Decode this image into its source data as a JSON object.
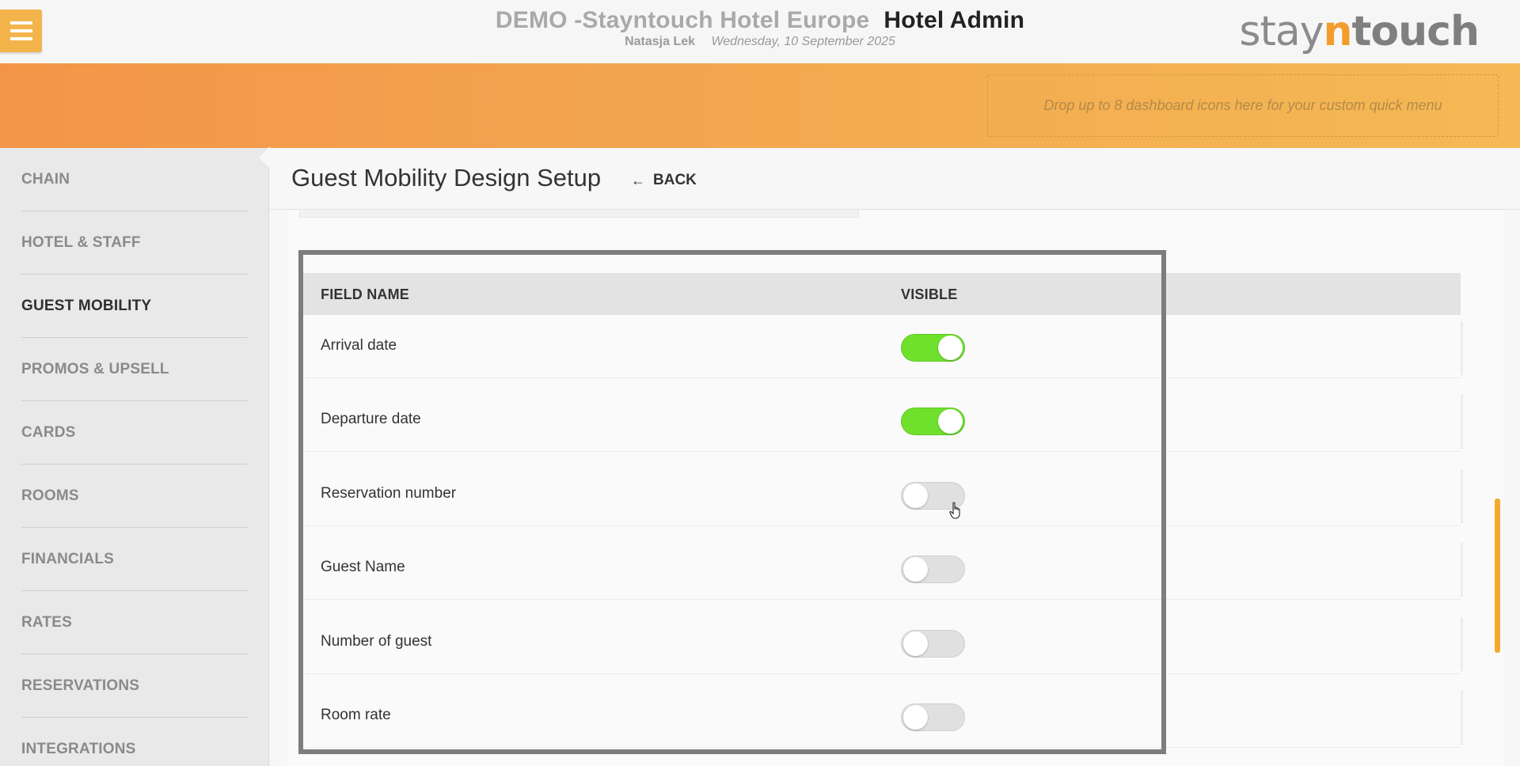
{
  "header": {
    "hotel_name": "DEMO -Stayntouch Hotel Europe",
    "app_name": "Hotel Admin",
    "user": "Natasja Lek",
    "date": "Wednesday, 10 September 2025",
    "logo": {
      "part1": "stay",
      "part2": "n",
      "part3": "touch"
    }
  },
  "banner": {
    "dropzone_text": "Drop up to 8 dashboard icons here for your custom quick menu"
  },
  "sidebar": {
    "items": [
      {
        "label": "CHAIN"
      },
      {
        "label": "HOTEL & STAFF"
      },
      {
        "label": "GUEST MOBILITY",
        "active": true
      },
      {
        "label": "PROMOS & UPSELL"
      },
      {
        "label": "CARDS"
      },
      {
        "label": "ROOMS"
      },
      {
        "label": "FINANCIALS"
      },
      {
        "label": "RATES"
      },
      {
        "label": "RESERVATIONS"
      },
      {
        "label": "INTEGRATIONS"
      }
    ]
  },
  "page": {
    "title": "Guest Mobility Design Setup",
    "back_label": "BACK"
  },
  "table": {
    "columns": {
      "field_name": "FIELD NAME",
      "visible": "VISIBLE"
    },
    "rows": [
      {
        "label": "Arrival date",
        "visible": true
      },
      {
        "label": "Departure date",
        "visible": true
      },
      {
        "label": "Reservation number",
        "visible": false
      },
      {
        "label": "Guest Name",
        "visible": false
      },
      {
        "label": "Number of guest",
        "visible": false
      },
      {
        "label": "Room rate",
        "visible": false
      }
    ]
  },
  "colors": {
    "accent_orange": "#f4b44c",
    "toggle_on": "#6fe12d",
    "toggle_off": "#e0e0e0"
  }
}
